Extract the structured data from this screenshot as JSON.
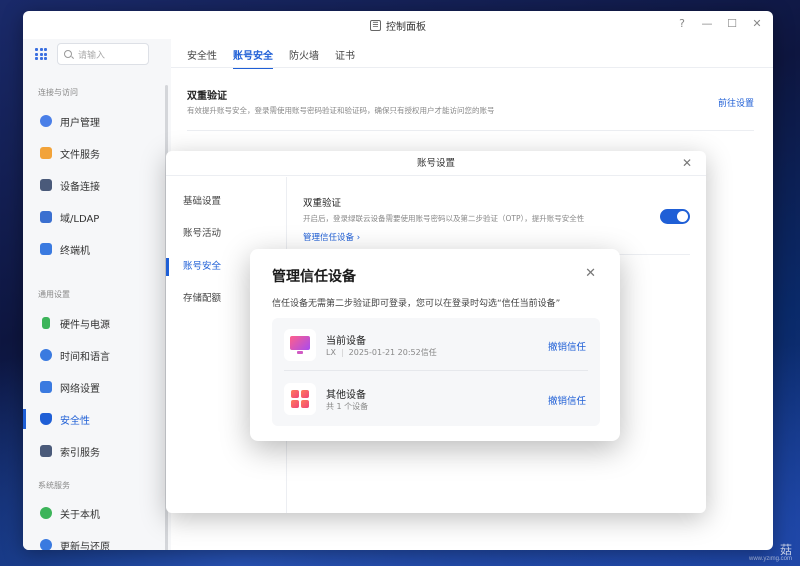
{
  "window": {
    "title": "控制面板",
    "controls": [
      "?",
      "—",
      "☐",
      "✕"
    ]
  },
  "sidebar": {
    "search_placeholder": "请输入",
    "sections": [
      {
        "label": "连接与访问"
      },
      {
        "label": "通用设置"
      },
      {
        "label": "系统服务"
      }
    ],
    "items": [
      {
        "label": "用户管理",
        "icon": "user-icon",
        "color": "#4a7fe8"
      },
      {
        "label": "文件服务",
        "icon": "folder-icon",
        "color": "#f2a33a"
      },
      {
        "label": "设备连接",
        "icon": "device-icon",
        "color": "#4a5a7a"
      },
      {
        "label": "域/LDAP",
        "icon": "domain-icon",
        "color": "#3a6fd0"
      },
      {
        "label": "终端机",
        "icon": "terminal-icon",
        "color": "#3a7ae0"
      },
      {
        "label": "硬件与电源",
        "icon": "battery-icon",
        "color": "#3cb45a"
      },
      {
        "label": "时间和语言",
        "icon": "clock-icon",
        "color": "#3a7ae0"
      },
      {
        "label": "网络设置",
        "icon": "network-icon",
        "color": "#3a7ae0"
      },
      {
        "label": "安全性",
        "icon": "shield-icon",
        "color": "#1f5fd6",
        "active": true
      },
      {
        "label": "索引服务",
        "icon": "index-icon",
        "color": "#4a5a7a"
      },
      {
        "label": "关于本机",
        "icon": "info-icon",
        "color": "#3cb45a"
      },
      {
        "label": "更新与还原",
        "icon": "sync-icon",
        "color": "#3a7ae0"
      }
    ]
  },
  "main": {
    "tabs": [
      {
        "label": "安全性"
      },
      {
        "label": "账号安全",
        "active": true
      },
      {
        "label": "防火墙"
      },
      {
        "label": "证书"
      }
    ],
    "section_title": "双重验证",
    "section_desc": "有效提升账号安全，登录需使用账号密码验证和验证码，确保只有授权用户才能访问您的账号",
    "section_link": "前往设置"
  },
  "account_dialog": {
    "title": "账号设置",
    "nav": [
      {
        "label": "基础设置"
      },
      {
        "label": "账号活动"
      },
      {
        "label": "账号安全",
        "active": true
      },
      {
        "label": "存储配额"
      }
    ],
    "two_factor_title": "双重验证",
    "two_factor_desc": "开启后，登录绿联云设备需要使用账号密码以及第二步验证（OTP），提升账号安全性",
    "manage_link": "管理信任设备 ›",
    "toggle_on": true
  },
  "trusted_dialog": {
    "title": "管理信任设备",
    "desc": "信任设备无需第二步验证即可登录，您可以在登录时勾选“信任当前设备”",
    "devices": [
      {
        "name": "当前设备",
        "user": "LX",
        "meta": "2025-01-21 20:52信任",
        "action": "撤销信任",
        "icon": "monitor-icon"
      },
      {
        "name": "其他设备",
        "meta": "共 1 个设备",
        "action": "撤销信任",
        "icon": "devices-grid-icon"
      }
    ]
  },
  "watermark": {
    "text": "菇",
    "url": "www.yzimg.com"
  }
}
